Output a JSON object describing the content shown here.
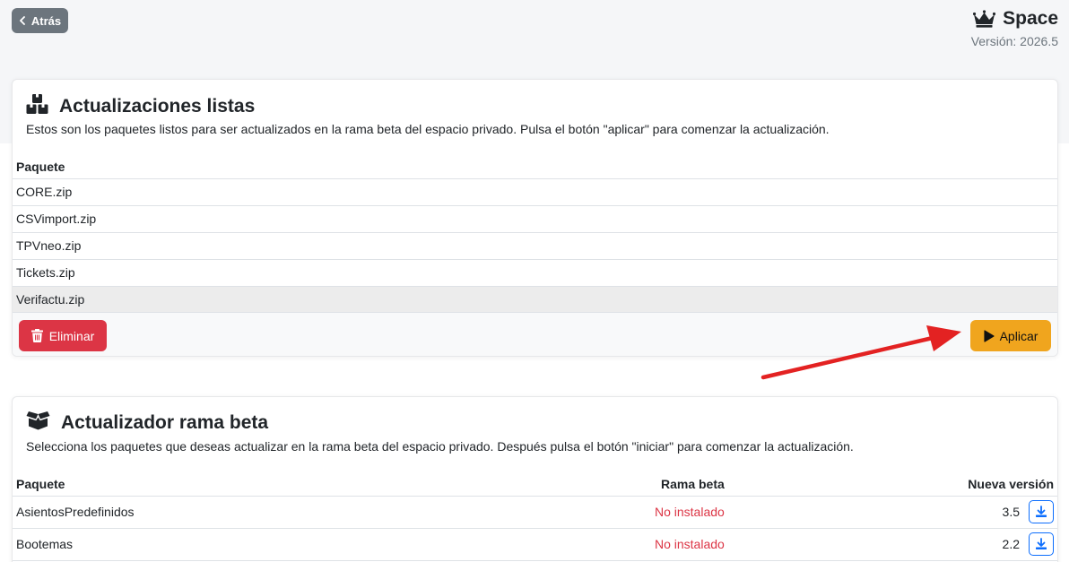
{
  "header": {
    "back_label": "Atrás",
    "brand_title": "Space",
    "version_text": "Versión: 2026.5"
  },
  "ready": {
    "title": "Actualizaciones listas",
    "description": "Estos son los paquetes listos para ser actualizados en la rama beta del espacio privado. Pulsa el botón \"aplicar\" para comenzar la actualización.",
    "column_header": "Paquete",
    "rows": [
      "CORE.zip",
      "CSVimport.zip",
      "TPVneo.zip",
      "Tickets.zip",
      "Verifactu.zip"
    ],
    "delete_label": "Eliminar",
    "apply_label": "Aplicar"
  },
  "updater": {
    "title": "Actualizador rama beta",
    "description": "Selecciona los paquetes que deseas actualizar en la rama beta del espacio privado. Después pulsa el botón \"iniciar\" para comenzar la actualización.",
    "columns": [
      "Paquete",
      "Rama beta",
      "Nueva versión"
    ],
    "rows": [
      {
        "name": "AsientosPredefinidos",
        "status": "No instalado",
        "version": "3.5"
      },
      {
        "name": "Bootemas",
        "status": "No instalado",
        "version": "2.2"
      }
    ]
  },
  "colors": {
    "danger": "#dc3545",
    "warning": "#f0a51e",
    "secondary": "#6c757d",
    "primary": "#0d6efd",
    "annotation_arrow": "#e32222"
  }
}
